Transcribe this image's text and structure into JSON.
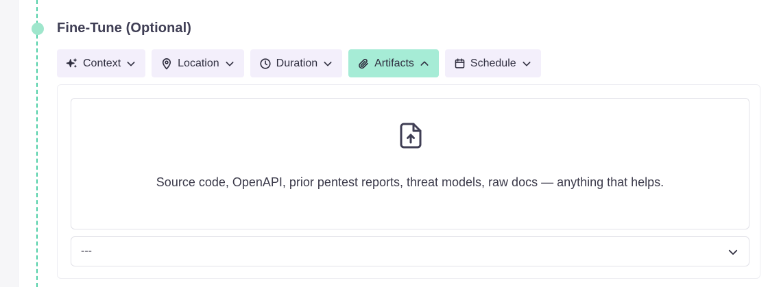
{
  "section": {
    "title": "Fine-Tune (Optional)"
  },
  "chips": [
    {
      "label": "Context",
      "icon": "sparkles-icon",
      "state": "collapsed"
    },
    {
      "label": "Location",
      "icon": "map-pin-icon",
      "state": "collapsed"
    },
    {
      "label": "Duration",
      "icon": "clock-icon",
      "state": "collapsed"
    },
    {
      "label": "Artifacts",
      "icon": "paperclip-icon",
      "state": "expanded"
    },
    {
      "label": "Schedule",
      "icon": "calendar-icon",
      "state": "collapsed"
    }
  ],
  "artifacts": {
    "upload_icon": "file-upload-icon",
    "dropzone_text": "Source code, OpenAPI, prior pentest reports, threat models, raw docs — anything that helps.",
    "select_value": "---"
  },
  "colors": {
    "accent": "#4fcfa6",
    "active_chip": "#a6ecd6",
    "chip_bg": "#f3effb",
    "text": "#3b3a4a"
  }
}
